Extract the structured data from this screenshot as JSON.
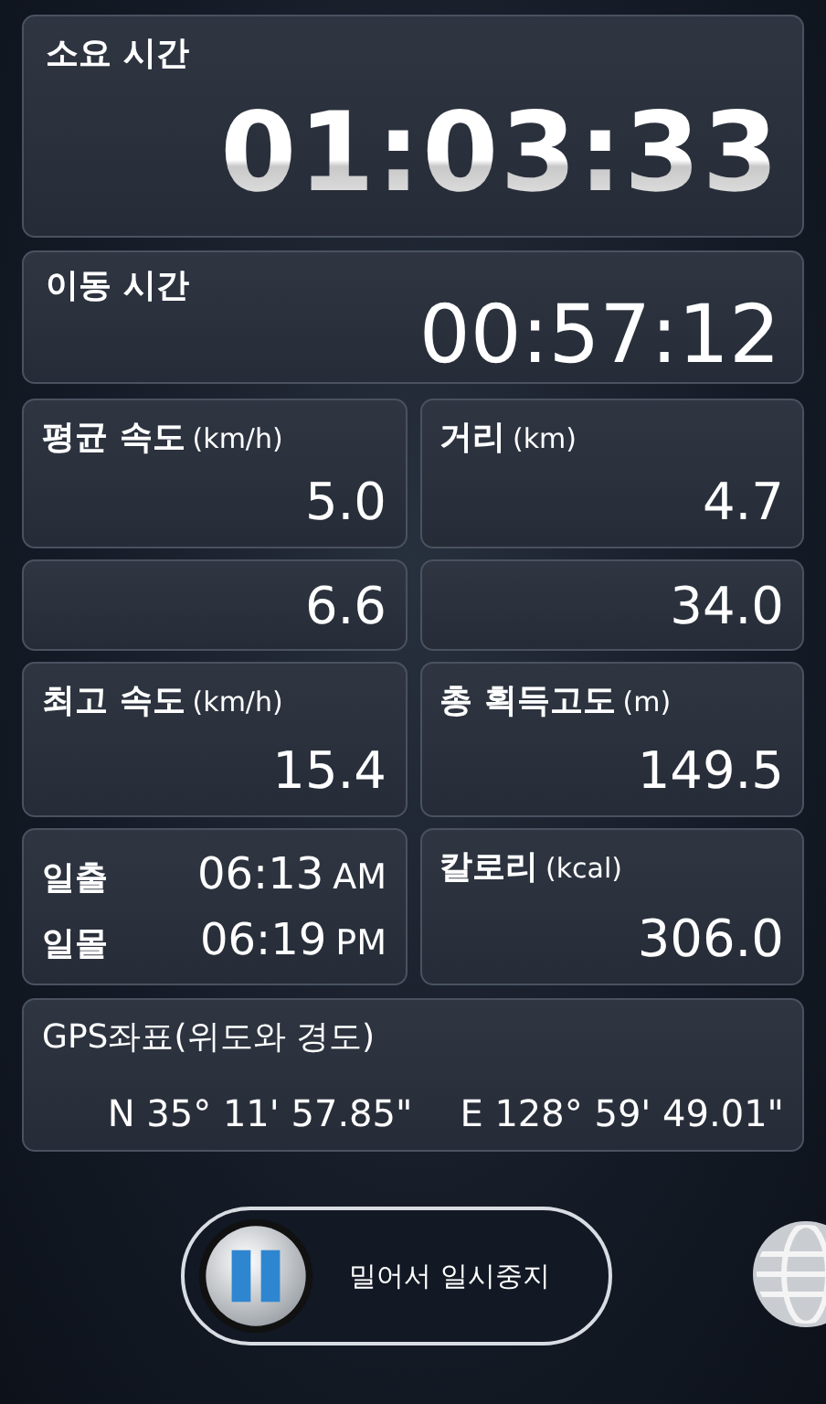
{
  "total_time": {
    "label": "소요 시간",
    "value": "01:03:33"
  },
  "moving_time": {
    "label": "이동 시간",
    "value": "00:57:12"
  },
  "tiles": [
    {
      "kind": "stat",
      "label": "평균 속도",
      "unit": "(km/h)",
      "value": "5.0"
    },
    {
      "kind": "stat",
      "label": "거리",
      "unit": "(km)",
      "value": "4.7"
    },
    {
      "kind": "value",
      "value": "6.6"
    },
    {
      "kind": "value",
      "value": "34.0"
    },
    {
      "kind": "stat",
      "label": "최고 속도",
      "unit": "(km/h)",
      "value": "15.4"
    },
    {
      "kind": "stat",
      "label": "총 획득고도",
      "unit": "(m)",
      "value": "149.5"
    },
    {
      "kind": "sun",
      "rows": [
        {
          "label": "일출",
          "time": "06:13",
          "period": "AM"
        },
        {
          "label": "일몰",
          "time": "06:19",
          "period": "PM"
        }
      ]
    },
    {
      "kind": "stat",
      "label": "칼로리",
      "unit": "(kcal)",
      "value": "306.0"
    }
  ],
  "gps": {
    "label": "GPS좌표(위도와 경도)",
    "latitude": "N 35° 11' 57.85\"",
    "longitude": "E 128° 59' 49.01\""
  },
  "pause_slider": {
    "label": "밀어서 일시중지",
    "level": 0
  }
}
